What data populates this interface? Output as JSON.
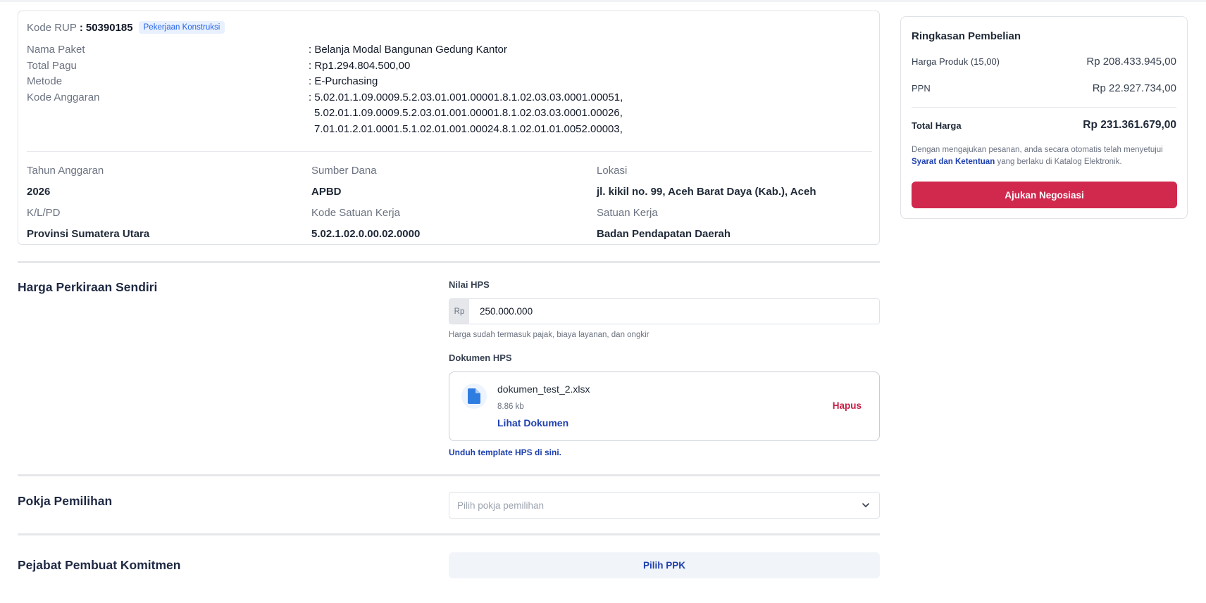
{
  "rup": {
    "code_label": "Kode RUP",
    "code_value": "50390185",
    "badge": "Pekerjaan Konstruksi",
    "nama_paket_label": "Nama Paket",
    "nama_paket_value": ": Belanja Modal Bangunan Gedung Kantor",
    "total_pagu_label": "Total Pagu",
    "total_pagu_value": ": Rp1.294.804.500,00",
    "metode_label": "Metode",
    "metode_value": ": E-Purchasing",
    "kode_anggaran_label": "Kode Anggaran",
    "kode_anggaran_values": [
      ": 5.02.01.1.09.0009.5.2.03.01.001.00001.8.1.02.03.03.0001.00051,",
      "5.02.01.1.09.0009.5.2.03.01.001.00001.8.1.02.03.03.0001.00026,",
      "7.01.01.2.01.0001.5.1.02.01.001.00024.8.1.02.01.01.0052.00003,"
    ],
    "grid": [
      {
        "label": "Tahun Anggaran",
        "value": "2026"
      },
      {
        "label": "Sumber Dana",
        "value": "APBD"
      },
      {
        "label": "Lokasi",
        "value": "jl. kikil no. 99, Aceh Barat Daya (Kab.), Aceh"
      },
      {
        "label": "K/L/PD",
        "value": "Provinsi Sumatera Utara"
      },
      {
        "label": "Kode Satuan Kerja",
        "value": "5.02.1.02.0.00.02.0000"
      },
      {
        "label": "Satuan Kerja",
        "value": "Badan Pendapatan Daerah"
      }
    ]
  },
  "hps": {
    "section_title": "Harga Perkiraan Sendiri",
    "nilai_label": "Nilai HPS",
    "prefix": "Rp",
    "value": "250.000.000",
    "helper": "Harga sudah termasuk pajak, biaya layanan, dan ongkir",
    "doc_label": "Dokumen HPS",
    "doc_name": "dokumen_test_2.xlsx",
    "doc_size": "8.86 kb",
    "doc_view": "Lihat Dokumen",
    "doc_remove": "Hapus",
    "template_link": "Unduh template HPS di sini."
  },
  "pokja": {
    "section_title": "Pokja Pemilihan",
    "placeholder": "Pilih pokja pemilihan"
  },
  "ppk": {
    "section_title": "Pejabat Pembuat Komitmen",
    "button": "Pilih PPK"
  },
  "summary": {
    "title": "Ringkasan Pembelian",
    "harga_produk_label": "Harga Produk (15,00)",
    "harga_produk_value": "Rp 208.433.945,00",
    "ppn_label": "PPN",
    "ppn_value": "Rp 22.927.734,00",
    "total_label": "Total Harga",
    "total_value": "Rp 231.361.679,00",
    "note_prefix": "Dengan mengajukan pesanan, anda secara otomatis telah menyetujui",
    "note_link": "Syarat dan Ketentuan",
    "note_suffix": "yang berlaku di Katalog Elektronik.",
    "button": "Ajukan Negosiasi"
  },
  "colors": {
    "accent_blue": "#1e40af",
    "danger": "#c81e45",
    "primary_button": "#d1284e"
  }
}
